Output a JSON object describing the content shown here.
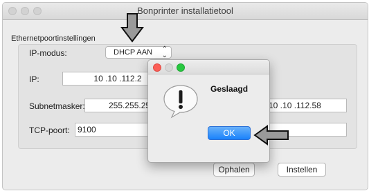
{
  "window": {
    "title": "Bonprinter installatietool"
  },
  "ethernet": {
    "group_label": "Ethernetpoortinstellingen",
    "ip_mode_label": "IP-modus:",
    "ip_mode_value": "DHCP AAN",
    "ip_label": "IP:",
    "ip_value": "10 .10 .112.2",
    "subnet_label": "Subnetmasker:",
    "subnet_value": "255.255.25",
    "gateway_value": "10 .10 .112.58",
    "tcp_label": "TCP-poort:",
    "tcp_value": "9100"
  },
  "buttons": {
    "fetch": "Ophalen",
    "set": "Instellen"
  },
  "dialog": {
    "message": "Geslaagd",
    "ok": "OK"
  },
  "icons": {
    "alert": "exclamation-speech-bubble-icon",
    "arrows": [
      "down-arrow-callout-icon",
      "left-arrow-callout-icon"
    ]
  },
  "colors": {
    "ok_button": "#1a82fb",
    "dialog_close": "#fc5f57",
    "dialog_minimize": "#d8d8d8",
    "dialog_zoom": "#28c840"
  }
}
